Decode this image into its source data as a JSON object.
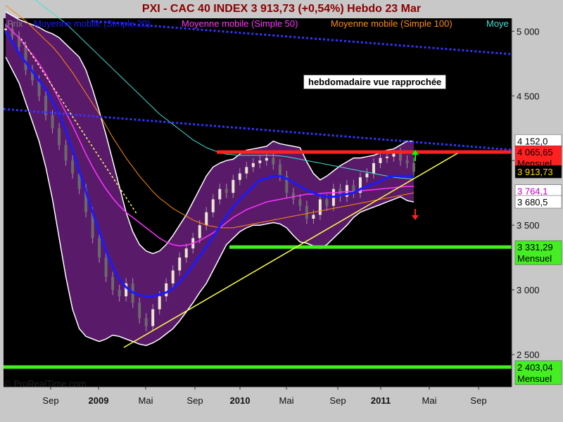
{
  "header": {
    "title": "PXI - CAC 40 INDEX     3 913,73 (+0,54%)     Hebdo  23 Mar"
  },
  "chart_data": {
    "type": "line",
    "instrument": "PXI - CAC 40 INDEX",
    "last_price": "3 913,73",
    "change": "(+0,54%)",
    "period": "Hebdo",
    "date": "23 Mar",
    "legend": [
      {
        "label": "Prix",
        "color": "#7a7a7a"
      },
      {
        "label": "Moyenne mobile (Simple 20)",
        "color": "#1a1aff"
      },
      {
        "label": "Moyenne mobile (Simple 50)",
        "color": "#ff33ff"
      },
      {
        "label": "Moyenne mobile (Simple 100)",
        "color": "#ff8c00"
      },
      {
        "label": "Moye",
        "color": "#40e0d0"
      }
    ],
    "y_ticks": [
      "5 000",
      "4 500",
      "4 000",
      "3 500",
      "3 000",
      "2 500"
    ],
    "y_tick_values": [
      5000,
      4500,
      4000,
      3500,
      3000,
      2500
    ],
    "ylim": [
      2250,
      5100
    ],
    "x_ticks": [
      {
        "label": "Sep",
        "year": false
      },
      {
        "label": "2009",
        "year": true
      },
      {
        "label": "Mai",
        "year": false
      },
      {
        "label": "Sep",
        "year": false
      },
      {
        "label": "2010",
        "year": true
      },
      {
        "label": "Mai",
        "year": false
      },
      {
        "label": "Sep",
        "year": false
      },
      {
        "label": "2011",
        "year": true
      },
      {
        "label": "Mai",
        "year": false
      },
      {
        "label": "Sep",
        "year": false
      }
    ],
    "series": {
      "price": [
        5020,
        4960,
        4880,
        4700,
        4620,
        4500,
        4350,
        4250,
        4120,
        4000,
        3900,
        3780,
        3600,
        3400,
        3250,
        3100,
        3000,
        2950,
        3050,
        2900,
        2780,
        2720,
        2850,
        2950,
        3050,
        3150,
        3250,
        3320,
        3400,
        3500,
        3600,
        3700,
        3780,
        3750,
        3850,
        3900,
        3950,
        3980,
        4000,
        4020,
        3970,
        3880,
        3750,
        3700,
        3650,
        3550,
        3580,
        3700,
        3650,
        3780,
        3720,
        3810,
        3750,
        3870,
        3900,
        3980,
        4020,
        4030,
        4060,
        4000,
        3980,
        3913.73
      ],
      "sma20": [
        5000,
        4920,
        4830,
        4760,
        4690,
        4620,
        4550,
        4460,
        4360,
        4230,
        4080,
        3920,
        3760,
        3600,
        3450,
        3300,
        3180,
        3080,
        3020,
        2980,
        2960,
        2950,
        2950,
        2965,
        2980,
        3010,
        3060,
        3120,
        3190,
        3260,
        3330,
        3410,
        3490,
        3570,
        3640,
        3700,
        3750,
        3800,
        3850,
        3860,
        3880,
        3880,
        3860,
        3830,
        3800,
        3770,
        3750,
        3730,
        3720,
        3720,
        3730,
        3740,
        3750,
        3780,
        3800,
        3820,
        3840,
        3870,
        3880,
        3880,
        3880,
        3880
      ],
      "sma50": [
        5050,
        5000,
        4950,
        4880,
        4820,
        4750,
        4670,
        4570,
        4470,
        4370,
        4270,
        4160,
        4050,
        3950,
        3860,
        3780,
        3710,
        3650,
        3600,
        3560,
        3520,
        3480,
        3440,
        3400,
        3370,
        3350,
        3340,
        3345,
        3360,
        3380,
        3410,
        3440,
        3480,
        3520,
        3560,
        3590,
        3620,
        3640,
        3660,
        3680,
        3690,
        3700,
        3710,
        3720,
        3730,
        3740,
        3740,
        3745,
        3750,
        3750,
        3755,
        3760,
        3760,
        3765,
        3770,
        3775,
        3780,
        3785,
        3790,
        3795,
        3800,
        3800
      ],
      "sma100": [
        5200,
        5160,
        5120,
        5080,
        5030,
        4980,
        4930,
        4880,
        4820,
        4750,
        4680,
        4600,
        4520,
        4440,
        4360,
        4270,
        4180,
        4100,
        4020,
        3950,
        3880,
        3820,
        3760,
        3710,
        3670,
        3630,
        3600,
        3570,
        3540,
        3520,
        3500,
        3490,
        3480,
        3480,
        3480,
        3490,
        3500,
        3510,
        3520,
        3530,
        3540,
        3550,
        3560,
        3570,
        3580,
        3590,
        3600,
        3610,
        3620,
        3630,
        3640,
        3650,
        3660,
        3670,
        3680,
        3690,
        3700,
        3710,
        3720,
        3730,
        3740,
        3750
      ],
      "sma200": [
        5400,
        5360,
        5330,
        5290,
        5260,
        5220,
        5180,
        5140,
        5100,
        5060,
        5010,
        4960,
        4910,
        4860,
        4810,
        4760,
        4710,
        4660,
        4610,
        4560,
        4510,
        4460,
        4410,
        4360,
        4320,
        4280,
        4240,
        4200,
        4160,
        4130,
        4100,
        4080,
        4060,
        4050,
        4045,
        4040,
        4040,
        4040,
        4040,
        4040,
        4040,
        4035,
        4030,
        4020,
        4010,
        4000,
        3990,
        3980,
        3970,
        3960,
        3950,
        3940,
        3930,
        3920,
        3910,
        3900,
        3890,
        3880,
        3870,
        3865,
        3860,
        3855
      ],
      "bb_upper": [
        5150,
        5120,
        5090,
        5070,
        5050,
        5030,
        5000,
        4980,
        4950,
        4900,
        4850,
        4800,
        4700,
        4550,
        4380,
        4200,
        4000,
        3800,
        3600,
        3450,
        3350,
        3300,
        3280,
        3300,
        3350,
        3420,
        3500,
        3580,
        3680,
        3780,
        3880,
        3950,
        3980,
        4000,
        4010,
        4050,
        4080,
        4090,
        4100,
        4110,
        4150,
        4130,
        4120,
        4110,
        4100,
        3990,
        3900,
        3850,
        3880,
        3920,
        3960,
        3990,
        4020,
        4020,
        4030,
        4040,
        4060,
        4080,
        4090,
        4120,
        4150,
        4150
      ],
      "bb_lower": [
        4800,
        4700,
        4600,
        4450,
        4300,
        4150,
        3950,
        3700,
        3400,
        3100,
        2850,
        2700,
        2640,
        2620,
        2600,
        2620,
        2650,
        2640,
        2620,
        2600,
        2580,
        2570,
        2590,
        2620,
        2660,
        2700,
        2760,
        2830,
        2900,
        2980,
        3050,
        3150,
        3250,
        3350,
        3400,
        3450,
        3480,
        3500,
        3500,
        3510,
        3520,
        3510,
        3480,
        3420,
        3370,
        3360,
        3340,
        3320,
        3350,
        3400,
        3450,
        3500,
        3560,
        3600,
        3620,
        3640,
        3660,
        3680,
        3700,
        3720,
        3690,
        3680
      ]
    },
    "price_labels": [
      {
        "value": 4152.0,
        "text": "4 152,0",
        "bg": "#ffffff",
        "fg": "#000000",
        "sub": ""
      },
      {
        "value": 4065.65,
        "text": "4 065,65",
        "bg": "#ff2020",
        "fg": "#000000",
        "sub": "Mensuel"
      },
      {
        "value": 3913.73,
        "text": "3 913,73",
        "bg": "#000000",
        "fg": "#ffd700",
        "sub": ""
      },
      {
        "value": 3764.1,
        "text": "3 764,1",
        "bg": "#ffffff",
        "fg": "#c000c0",
        "sub": ""
      },
      {
        "value": 3680.5,
        "text": "3 680,5",
        "bg": "#ffffff",
        "fg": "#000000",
        "sub": ""
      },
      {
        "value": 3331.29,
        "text": "3 331,29",
        "bg": "#44ee22",
        "fg": "#000000",
        "sub": "Mensuel"
      },
      {
        "value": 2403.04,
        "text": "2 403,04",
        "bg": "#44ee22",
        "fg": "#000000",
        "sub": "Mensuel"
      }
    ],
    "levels": [
      {
        "value": 4065.65,
        "color": "#ff2020",
        "label": "Mensuel"
      },
      {
        "value": 3331.29,
        "color": "#44ee22",
        "label": "Mensuel"
      },
      {
        "value": 2403.04,
        "color": "#44ee22",
        "label": "Mensuel"
      }
    ],
    "annotation": "hebdomadaire vue rapprochée",
    "grid": false,
    "legend_position": "top-left"
  },
  "watermark": "© ProRealTime.com"
}
